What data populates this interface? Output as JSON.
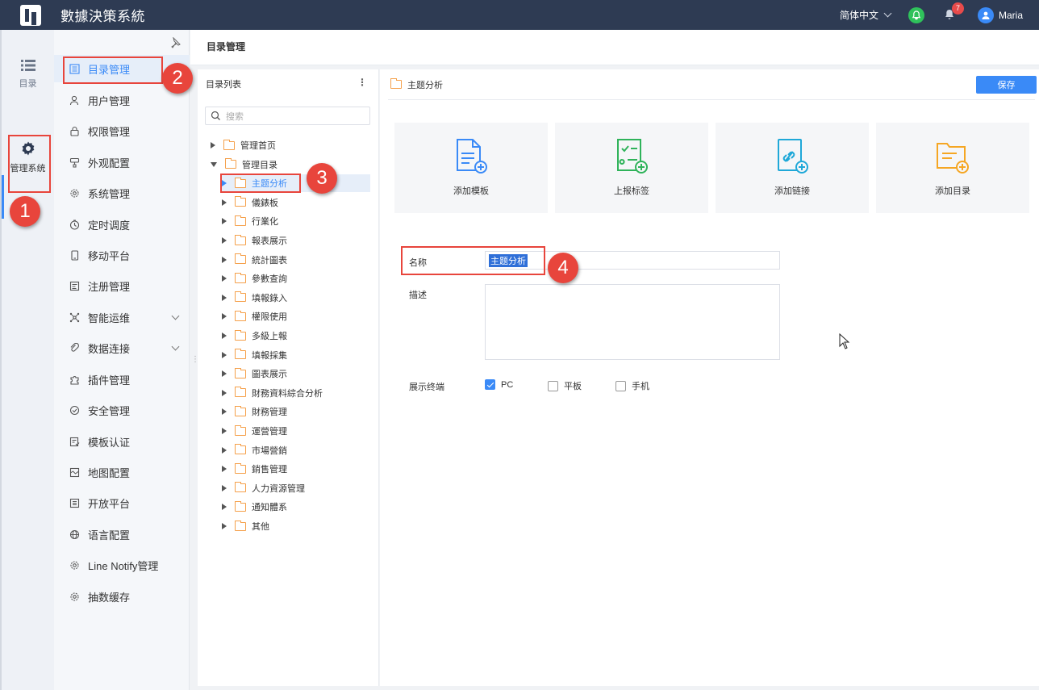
{
  "header": {
    "app_title": "數據決策系統",
    "language": "简体中文",
    "notification_count": "7",
    "user_name": "Maria"
  },
  "rail": {
    "items": [
      {
        "label": "目录",
        "icon": "list-icon"
      },
      {
        "label": "管理系统",
        "icon": "gear-icon"
      }
    ]
  },
  "menu": {
    "items": [
      {
        "label": "目录管理",
        "icon": "catalog-icon"
      },
      {
        "label": "用户管理",
        "icon": "user-icon"
      },
      {
        "label": "权限管理",
        "icon": "lock-icon"
      },
      {
        "label": "外观配置",
        "icon": "brush-icon"
      },
      {
        "label": "系统管理",
        "icon": "gear-icon"
      },
      {
        "label": "定时调度",
        "icon": "timer-icon"
      },
      {
        "label": "移动平台",
        "icon": "mobile-icon"
      },
      {
        "label": "注册管理",
        "icon": "register-icon"
      },
      {
        "label": "智能运维",
        "icon": "network-icon"
      },
      {
        "label": "数据连接",
        "icon": "link-icon"
      },
      {
        "label": "插件管理",
        "icon": "puzzle-icon"
      },
      {
        "label": "安全管理",
        "icon": "shield-icon"
      },
      {
        "label": "模板认证",
        "icon": "template-icon"
      },
      {
        "label": "地图配置",
        "icon": "map-icon"
      },
      {
        "label": "开放平台",
        "icon": "open-platform-icon"
      },
      {
        "label": "语言配置",
        "icon": "globe-icon"
      },
      {
        "label": "Line Notify管理",
        "icon": "gear-icon"
      },
      {
        "label": "抽数缓存",
        "icon": "gear-icon"
      }
    ]
  },
  "breadcrumb": "目录管理",
  "tree": {
    "title": "目录列表",
    "more": "⋮",
    "search_placeholder": "搜索",
    "nodes": [
      "管理首页",
      "管理目录",
      "主题分析",
      "儀錶板",
      "行業化",
      "報表展示",
      "統計圖表",
      "參數查詢",
      "填報錄入",
      "權限使用",
      "多級上報",
      "填報採集",
      "圖表展示",
      "財務資料綜合分析",
      "財務管理",
      "運營管理",
      "市場營銷",
      "銷售管理",
      "人力資源管理",
      "通知體系",
      "其他"
    ]
  },
  "content": {
    "title": "主题分析",
    "save_label": "保存",
    "cards": [
      {
        "label": "添加模板",
        "icon": "add-template-icon",
        "color": "#3a8af7"
      },
      {
        "label": "上报标签",
        "icon": "add-tag-icon",
        "color": "#2fb35a"
      },
      {
        "label": "添加链接",
        "icon": "add-link-icon",
        "color": "#1fa8d8"
      },
      {
        "label": "添加目录",
        "icon": "add-folder-icon",
        "color": "#f5a623"
      }
    ],
    "form": {
      "name_label": "名称",
      "name_value": "主题分析",
      "desc_label": "描述",
      "terminal_label": "展示终端",
      "options": [
        {
          "label": "PC",
          "checked": true
        },
        {
          "label": "平板",
          "checked": false
        },
        {
          "label": "手机",
          "checked": false
        }
      ]
    }
  },
  "annotations": [
    "1",
    "2",
    "3",
    "4"
  ]
}
